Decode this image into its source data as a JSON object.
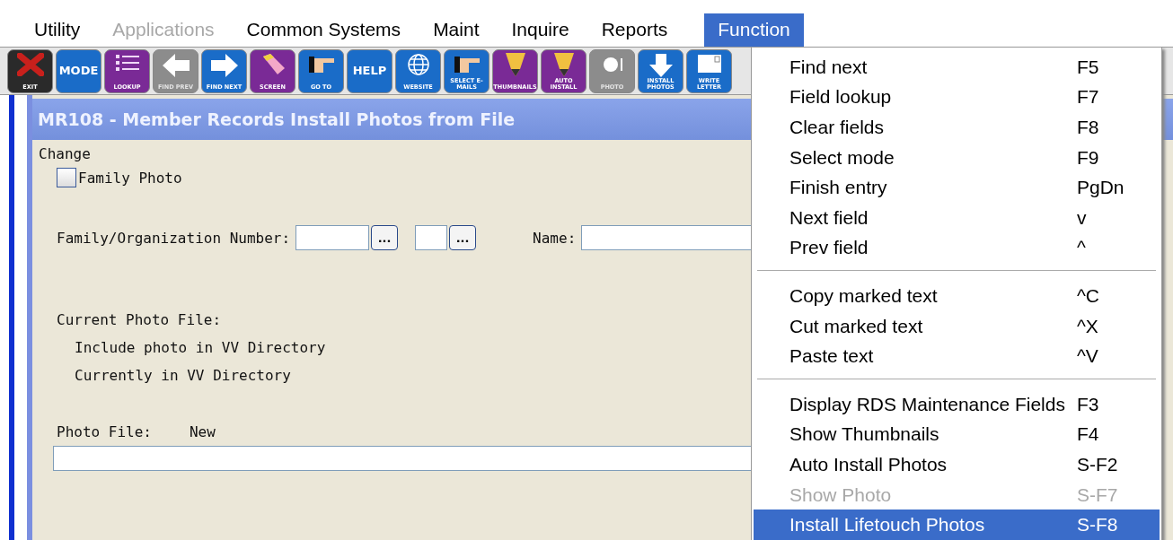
{
  "menubar": [
    {
      "label": "Utility",
      "disabled": false,
      "selected": false
    },
    {
      "label": "Applications",
      "disabled": true,
      "selected": false
    },
    {
      "label": "Common Systems",
      "disabled": false,
      "selected": false
    },
    {
      "label": "Maint",
      "disabled": false,
      "selected": false
    },
    {
      "label": "Inquire",
      "disabled": false,
      "selected": false
    },
    {
      "label": "Reports",
      "disabled": false,
      "selected": false
    },
    {
      "label": "Function",
      "disabled": false,
      "selected": true
    }
  ],
  "toolbar": [
    {
      "label": "EXIT",
      "kind": "x",
      "color": "#2a2a2a",
      "disabled": false
    },
    {
      "label": "MODE",
      "kind": "word",
      "color": "#1a6cc8",
      "disabled": false
    },
    {
      "label": "LOOKUP",
      "kind": "list",
      "color": "#7a2a96",
      "disabled": false
    },
    {
      "label": "FIND PREV",
      "kind": "arrow-left",
      "color": "#8c8c8c",
      "disabled": true
    },
    {
      "label": "FIND NEXT",
      "kind": "arrow-right",
      "color": "#1a6cc8",
      "disabled": false
    },
    {
      "label": "SCREEN",
      "kind": "eraser",
      "color": "#7a2a96",
      "disabled": false
    },
    {
      "label": "GO TO",
      "kind": "hand",
      "color": "#1a6cc8",
      "disabled": false
    },
    {
      "label": "HELP",
      "kind": "word",
      "color": "#1a6cc8",
      "disabled": false
    },
    {
      "label": "WEBSITE",
      "kind": "globe",
      "color": "#1a6cc8",
      "disabled": false
    },
    {
      "label": "SELECT E-MAILS",
      "kind": "hand",
      "color": "#1a6cc8",
      "disabled": false
    },
    {
      "label": "THUMBNAILS",
      "kind": "pencil",
      "color": "#7a2a96",
      "disabled": false
    },
    {
      "label": "AUTO INSTALL",
      "kind": "pencil",
      "color": "#7a2a96",
      "disabled": false
    },
    {
      "label": "PHOTO",
      "kind": "camera",
      "color": "#8c8c8c",
      "disabled": true
    },
    {
      "label": "INSTALL PHOTOS",
      "kind": "arrow-down",
      "color": "#1a6cc8",
      "disabled": false
    },
    {
      "label": "WRITE LETTER",
      "kind": "paper",
      "color": "#1a6cc8",
      "disabled": false
    }
  ],
  "window": {
    "title": "MR108 - Member Records Install Photos from File",
    "mode": "Change",
    "family_photo": {
      "label": "Family Photo",
      "checked": false
    },
    "family_number": {
      "label": "Family/Organization Number:",
      "lookup_buttons": [
        "...",
        "..."
      ]
    },
    "name": {
      "label": "Name:"
    },
    "current_photo_file": {
      "label": "Current Photo File:",
      "lines": [
        "Include photo in VV Directory",
        "Currently in VV Directory"
      ]
    },
    "photo_file": {
      "label": "Photo File:",
      "status": "New"
    }
  },
  "function_menu": {
    "groups": [
      [
        {
          "label": "Find next",
          "shortcut": "F5",
          "disabled": false,
          "selected": false
        },
        {
          "label": "Field lookup",
          "shortcut": "F7",
          "disabled": false,
          "selected": false
        },
        {
          "label": "Clear fields",
          "shortcut": "F8",
          "disabled": false,
          "selected": false
        },
        {
          "label": "Select mode",
          "shortcut": "F9",
          "disabled": false,
          "selected": false
        },
        {
          "label": "Finish entry",
          "shortcut": "PgDn",
          "disabled": false,
          "selected": false
        },
        {
          "label": "Next field",
          "shortcut": "v",
          "disabled": false,
          "selected": false
        },
        {
          "label": "Prev field",
          "shortcut": "^",
          "disabled": false,
          "selected": false
        }
      ],
      [
        {
          "label": "Copy marked text",
          "shortcut": "^C",
          "disabled": false,
          "selected": false
        },
        {
          "label": "Cut marked text",
          "shortcut": "^X",
          "disabled": false,
          "selected": false
        },
        {
          "label": "Paste text",
          "shortcut": "^V",
          "disabled": false,
          "selected": false
        }
      ],
      [
        {
          "label": "Display RDS Maintenance Fields",
          "shortcut": "F3",
          "disabled": false,
          "selected": false
        },
        {
          "label": "Show Thumbnails",
          "shortcut": "F4",
          "disabled": false,
          "selected": false
        },
        {
          "label": "Auto Install Photos",
          "shortcut": "S-F2",
          "disabled": false,
          "selected": false
        },
        {
          "label": "Show Photo",
          "shortcut": "S-F7",
          "disabled": true,
          "selected": false
        },
        {
          "label": "Install Lifetouch Photos",
          "shortcut": "S-F8",
          "disabled": false,
          "selected": true
        }
      ]
    ]
  }
}
